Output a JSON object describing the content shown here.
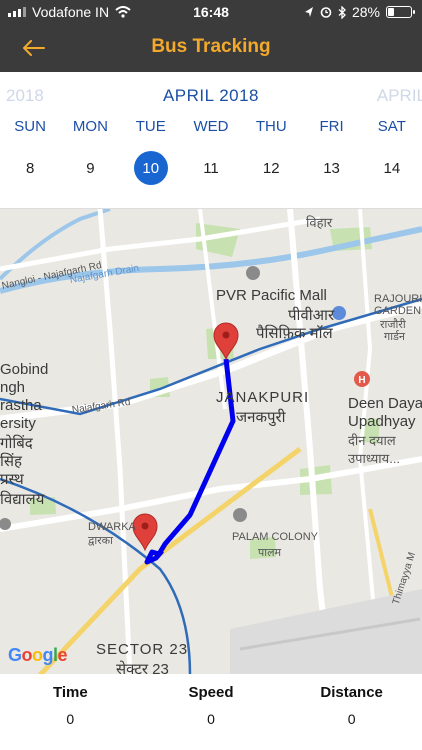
{
  "status_bar": {
    "carrier": "Vodafone IN",
    "time": "16:48",
    "battery": "28%",
    "battery_level": 0.28
  },
  "header": {
    "title": "Bus Tracking",
    "back_icon": "back-arrow-icon"
  },
  "calendar": {
    "prev_month": "2018",
    "current_month": "APRIL 2018",
    "next_month": "APRIL",
    "weekdays": [
      "SUN",
      "MON",
      "TUE",
      "WED",
      "THU",
      "FRI",
      "SAT"
    ],
    "dates": [
      "8",
      "9",
      "10",
      "11",
      "12",
      "13",
      "14"
    ],
    "selected_date": "10"
  },
  "map": {
    "labels": {
      "vihar": "विहार",
      "nangloi_rd": "Nangloi - Najafgarh Rd",
      "najafgarh_drain": "Najafgarh Drain",
      "pvr_en": "PVR Pacific Mall",
      "pvr_hi1": "पीवीआर",
      "pvr_hi2": "पैसिफ़िक मॉल",
      "rajouri_en1": "RAJOURI",
      "rajouri_en2": "GARDEN",
      "rajouri_hi1": "राजौरी",
      "rajouri_hi2": "गार्डन",
      "gobind1": "Gobind",
      "gobind2": "ngh",
      "gobind3": "rastha",
      "gobind4": "ersity",
      "gobind5": "गोबिंद",
      "gobind6": "सिंह",
      "gobind7": "प्रस्थ",
      "gobind8": "विद्यालय",
      "najafgarh_rd": "Najafgarh Rd",
      "janakpuri_en": "JANAKPURI",
      "janakpuri_hi": "जनकपुरी",
      "deen1": "Deen Dayal",
      "deen2": "Upadhyay",
      "deen3": "दीन दयाल",
      "deen4": "उपाध्याय...",
      "dwarka_en": "DWARKA",
      "dwarka_hi": "द्वारका",
      "palam_en": "PALAM COLONY",
      "palam_hi": "पालम",
      "sector_en": "SECTOR 23",
      "sector_hi": "सेक्टर 23",
      "thimayya": "Thimayya M",
      "google": "Google"
    },
    "colors": {
      "route": "#0000ee",
      "marker": "#e0403a",
      "water": "#9cc6ea",
      "park": "#c7e2b0",
      "road": "#ffffff",
      "rail": "#2f6bb8"
    }
  },
  "stats": {
    "time_label": "Time",
    "time_value": "0",
    "speed_label": "Speed",
    "speed_value": "0",
    "distance_label": "Distance",
    "distance_value": "0"
  }
}
